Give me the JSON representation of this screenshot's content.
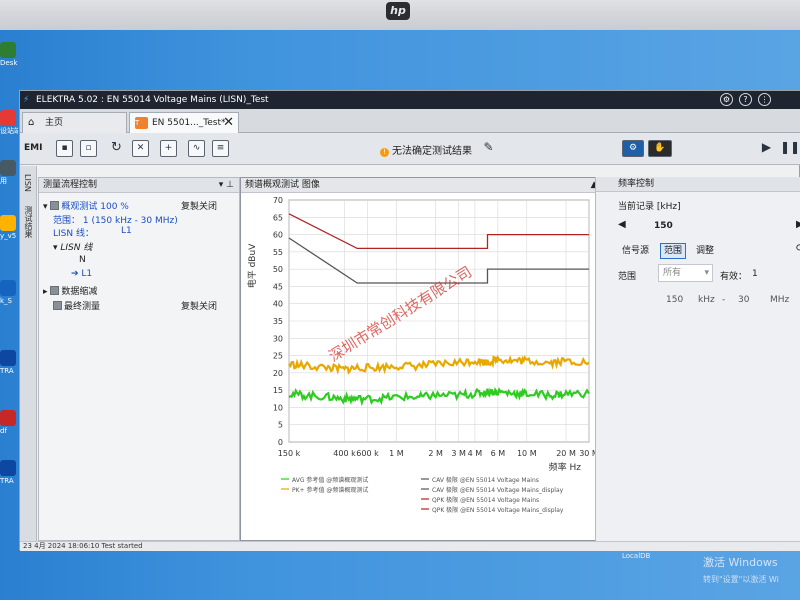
{
  "app": {
    "title": "ELEKTRA 5.02 : EN 55014 Voltage Mains  (LISN)_Test",
    "tabs": [
      {
        "label": "主页"
      },
      {
        "label": "EN 5501..._Test*"
      }
    ]
  },
  "desktop": {
    "labels": [
      "Desk",
      "设站端",
      "用",
      "c",
      "y_v5",
      "k_S",
      "TRA",
      "1",
      "df",
      "TRA",
      "1"
    ]
  },
  "toolbar": {
    "emi_label": "EMI",
    "warning_text": "无法确定测试结果"
  },
  "side_strip": {
    "labels": [
      "LISN",
      "测试结果"
    ]
  },
  "flow_panel": {
    "title": "测量流程控制",
    "overview_label": "概观测试 100 %",
    "overview_action": "复製关闭",
    "range_text": "范围：  1 (150 kHz - 30 MHz)",
    "lisn_line_label": "LISN 线：",
    "lisn_line_value": "L1",
    "lisn_group": "LISN 线",
    "lines": [
      "N",
      "L1"
    ],
    "data_reduction": "数据缩减",
    "final_measure": "最终测量",
    "final_action": "复製关闭"
  },
  "graph_panel": {
    "title": "频谱概观测试 图像",
    "watermark": "深圳市常创科技有限公司"
  },
  "chart_data": {
    "type": "line",
    "title": "",
    "xlabel": "频率 Hz",
    "ylabel": "电平 dBuV",
    "x_scale": "log",
    "xlim": [
      150000,
      30000000
    ],
    "ylim": [
      0,
      70
    ],
    "y_ticks": [
      0,
      5,
      10,
      15,
      20,
      25,
      30,
      35,
      40,
      45,
      50,
      55,
      60,
      65,
      70
    ],
    "y_tick_labels": [
      "0",
      "5",
      "10",
      "15",
      "20",
      "25",
      "30",
      "35",
      "40",
      "45",
      "50",
      "55",
      "60",
      "65",
      "70"
    ],
    "x_ticks": [
      150000,
      400000,
      600000,
      1000000,
      2000000,
      3000000,
      4000000,
      6000000,
      10000000,
      20000000,
      30000000
    ],
    "x_tick_labels": [
      "150 k",
      "400 k",
      "600 k",
      "1 M",
      "2 M",
      "3 M",
      "4 M",
      "6 M",
      "10 M",
      "20 M",
      "30 M"
    ],
    "grid": true,
    "series": [
      {
        "name": "QPK 极限 @EN 55014 Voltage Mains",
        "color": "#b22222",
        "x": [
          150000,
          500000,
          5000000,
          5000000,
          30000000
        ],
        "y": [
          66,
          56,
          56,
          60,
          60
        ]
      },
      {
        "name": "CAV 极限 @EN 55014 Voltage Mains",
        "color": "#555555",
        "x": [
          150000,
          500000,
          5000000,
          5000000,
          30000000
        ],
        "y": [
          59,
          46,
          46,
          50,
          50
        ]
      },
      {
        "name": "PK+ 参考值 @频谱概观测试",
        "color": "#e8a800",
        "x": [
          150000,
          200000,
          300000,
          400000,
          500000,
          700000,
          1000000,
          1500000,
          2000000,
          3000000,
          4000000,
          5000000,
          6000000,
          8000000,
          10000000,
          15000000,
          20000000,
          30000000
        ],
        "y": [
          22.5,
          22,
          21.5,
          21,
          21.5,
          21.5,
          22,
          22,
          22.5,
          23,
          23.5,
          23,
          24,
          23.5,
          23.5,
          23,
          23.5,
          23
        ]
      },
      {
        "name": "AVG 参考值 @频谱概观测试",
        "color": "#2ecc20",
        "x": [
          150000,
          200000,
          300000,
          400000,
          500000,
          700000,
          1000000,
          1500000,
          2000000,
          3000000,
          4000000,
          5000000,
          6000000,
          8000000,
          10000000,
          15000000,
          20000000,
          30000000
        ],
        "y": [
          14,
          13.5,
          13,
          12.5,
          12.5,
          12.5,
          13,
          13,
          13.5,
          13.5,
          14,
          14.5,
          14.5,
          14,
          14,
          13.5,
          14,
          14
        ]
      }
    ],
    "legend": {
      "placement": "bottom",
      "entries": [
        "AVG 参考值 @频谱概观测试",
        "PK+ 参考值 @频谱概观测试",
        "CAV 极限 @EN 55014 Voltage Mains",
        "CAV 极限 @EN 55014 Voltage Mains_display",
        "QPK 极限 @EN 55014 Voltage Mains",
        "QPK 极限 @EN 55014 Voltage Mains_display"
      ]
    }
  },
  "freq_panel": {
    "title": "频率控制",
    "current_record_label": "当前记录 [kHz]",
    "current_record_value": "150",
    "subtabs": [
      "信号源",
      "范围",
      "调整"
    ],
    "active_subtab": "范围",
    "range_label": "范围",
    "range_value": "所有",
    "valid_label": "有效：",
    "valid_value": "1",
    "start_value": "150",
    "start_unit": "kHz",
    "dash": "-",
    "stop_value": "30",
    "stop_unit": "MHz"
  },
  "status": {
    "text": "23 4月 2024 18:06:10  Test started",
    "db": "LocalDB"
  },
  "windows_watermark": {
    "line1": "激活 Windows",
    "line2": "转到\"设置\"以激活 Wi"
  }
}
